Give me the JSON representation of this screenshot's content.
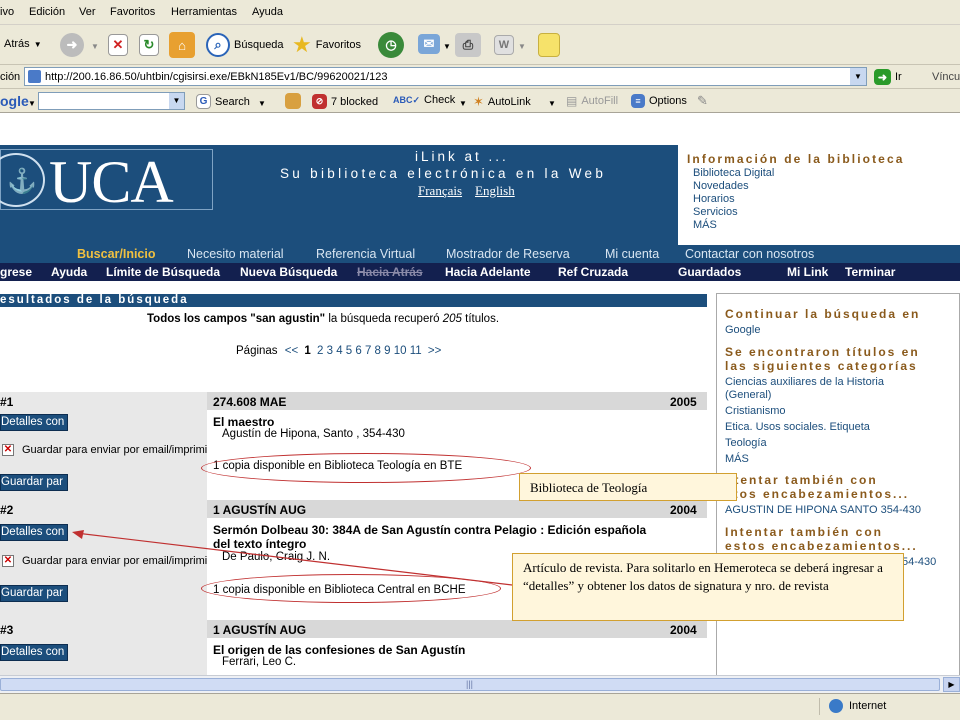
{
  "menubar": {
    "items": [
      "ivo",
      "Edición",
      "Ver",
      "Favoritos",
      "Herramientas",
      "Ayuda"
    ]
  },
  "toolbar": {
    "back_label": "Atrás",
    "search_label": "Búsqueda",
    "favorites_label": "Favoritos"
  },
  "addressbar": {
    "label": "ción",
    "url": "http://200.16.86.50/uhtbin/cgisirsi.exe/EBkN185Ev1/BC/99620021/123",
    "go_label": "Ir",
    "links_label": "Víncul"
  },
  "googlebar": {
    "brand": "ogle",
    "search_label": "Search",
    "blocked_label": "7 blocked",
    "check_label": "Check",
    "autolink_label": "AutoLink",
    "autofill_label": "AutoFill",
    "options_label": "Options"
  },
  "banner": {
    "logo_text": "UCA",
    "line1": "iLink at ...",
    "line2": "Su biblioteca electrónica en la Web",
    "lang_fr": "Français",
    "lang_en": "English"
  },
  "infobox": {
    "heading": "Información de la biblioteca",
    "links": [
      "Biblioteca Digital",
      "Novedades",
      "Horarios",
      "Servicios",
      "MÁS"
    ]
  },
  "nav1": {
    "items": [
      "Buscar/Inicio",
      "Necesito material",
      "Referencia Virtual",
      "Mostrador de Reserva",
      "Mi cuenta",
      "Contactar con nosotros"
    ]
  },
  "nav2": {
    "items": [
      "gresе",
      "Ayuda",
      "Límite de Búsqueda",
      "Nueva Búsqueda",
      "Hacia Atrás",
      "Hacia Adelante",
      "Ref Cruzada",
      "Guardados",
      "Mi Link",
      "Terminar"
    ]
  },
  "results": {
    "header": "esultados de la búsqueda",
    "summary_prefix": "Todos los campos \"san agustin\"",
    "summary_rest": " la búsqueda recuperó ",
    "summary_count": "205",
    "summary_suffix": " títulos.",
    "pages_label": "Páginas",
    "pages_prev": "<<",
    "pages_current": "1",
    "pages_rest": "2 3 4 5 6 7 8 9 10 11",
    "pages_next": ">>",
    "details_label": "Detalles con",
    "save_email_label": "Guardar para enviar por email/imprimir",
    "save_label": "Guardar par",
    "items": [
      {
        "num": "#1",
        "callno": "274.608 MAE",
        "year": "2005",
        "title": "El maestro",
        "author": "Agustín de Hipona, Santo , 354-430",
        "copy": "1 copia disponible en Biblioteca Teología en BTE"
      },
      {
        "num": "#2",
        "callno": "1 AGUSTÍN AUG",
        "year": "2004",
        "title": "Sermón Dolbeau 30: 384A de San Agustín contra Pelagio : Edición española",
        "title2": "del texto íntegro",
        "author": "De Paulo, Craig J. N.",
        "copy": "1 copia disponible en Biblioteca Central en BCHE"
      },
      {
        "num": "#3",
        "callno": "1 AGUSTÍN AUG",
        "year": "2004",
        "title": "El origen de las confesiones de San Agustín",
        "author": "Ferrari, Leo C."
      }
    ]
  },
  "sidebar": {
    "continue_heading": "Continuar la búsqueda en",
    "google_link": "Google",
    "found_heading1": "Se encontraron títulos en",
    "found_heading2": "las siguientes categorías",
    "cat1a": "Ciencias auxiliares de la Historia",
    "cat1b": "(General)",
    "cat2": "Cristianismo",
    "cat3": "Etica. Usos sociales. Etiqueta",
    "cat4": "Teología",
    "cat_more": "MÁS",
    "try_heading1a": "ntentar también con",
    "try_heading1b": "stos encabezamientos...",
    "try_link1": "AGUSTIN DE HIPONA SANTO 354-430",
    "try_heading2a": "Intentar también con",
    "try_heading2b": "estos encabezamientos...",
    "try_link2_tail": "54-430"
  },
  "callouts": {
    "teologia": "Biblioteca de Teología",
    "revista": "Artículo de revista. Para solitarlo en Hemeroteca se deberá ingresar a “detalles” y obtener los datos de signatura y nro. de revista"
  },
  "statusbar": {
    "zone": "Internet"
  },
  "colors": {
    "banner_blue": "#1c4e7c",
    "nav_dark": "#13204f",
    "heading_brown": "#8a5a1c",
    "annotation_red": "#c03030"
  }
}
